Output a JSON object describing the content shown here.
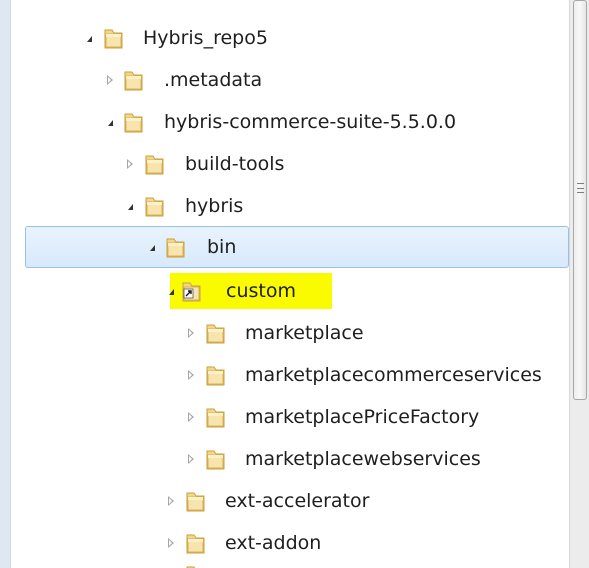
{
  "tree": {
    "items": [
      {
        "label": "Hybris_repo5",
        "state": "expanded"
      },
      {
        "label": ".metadata",
        "state": "collapsed"
      },
      {
        "label": "hybris-commerce-suite-5.5.0.0",
        "state": "expanded"
      },
      {
        "label": "build-tools",
        "state": "collapsed"
      },
      {
        "label": "hybris",
        "state": "expanded"
      },
      {
        "label": "bin",
        "state": "expanded",
        "selected": true
      },
      {
        "label": "custom",
        "state": "expanded",
        "highlighted": true,
        "shortcut": true
      },
      {
        "label": "marketplace",
        "state": "collapsed"
      },
      {
        "label": "marketplacecommerceservices",
        "state": "collapsed"
      },
      {
        "label": "marketplacePriceFactory",
        "state": "collapsed"
      },
      {
        "label": "marketplacewebservices",
        "state": "collapsed"
      },
      {
        "label": "ext-accelerator",
        "state": "collapsed"
      },
      {
        "label": "ext-addon",
        "state": "collapsed"
      }
    ]
  },
  "colors": {
    "highlight": "#fbfb00",
    "selection_border": "#98c1ea",
    "folder": "#e8c04a"
  },
  "icons": {
    "expanded": "triangle-down-icon",
    "collapsed": "triangle-right-icon",
    "folder": "folder-icon",
    "shortcut": "shortcut-arrow-icon"
  }
}
